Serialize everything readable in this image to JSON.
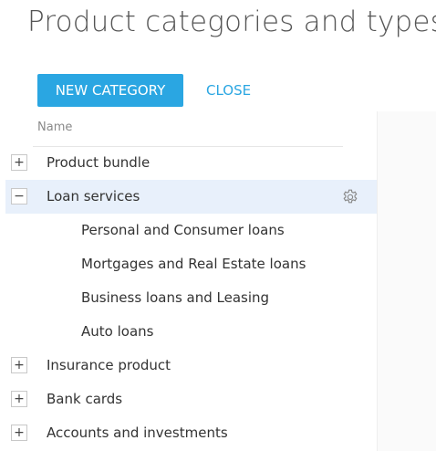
{
  "page": {
    "title": "Product categories and types"
  },
  "toolbar": {
    "new_category_label": "NEW CATEGORY",
    "close_label": "CLOSE"
  },
  "table": {
    "column_name": "Name"
  },
  "tree": {
    "items": [
      {
        "label": "Product bundle",
        "expanded": false
      },
      {
        "label": "Loan services",
        "expanded": true,
        "selected": true,
        "children": [
          {
            "label": "Personal and Consumer loans"
          },
          {
            "label": "Mortgages and Real Estate loans"
          },
          {
            "label": "Business loans and Leasing"
          },
          {
            "label": "Auto loans"
          }
        ]
      },
      {
        "label": "Insurance product",
        "expanded": false
      },
      {
        "label": "Bank cards",
        "expanded": false
      },
      {
        "label": "Accounts and investments",
        "expanded": false
      }
    ]
  },
  "icons": {
    "expand": "+",
    "collapse": "−",
    "settings": "gear-icon"
  },
  "colors": {
    "accent": "#2aa6e2",
    "selected_row": "#e8f0fb"
  }
}
